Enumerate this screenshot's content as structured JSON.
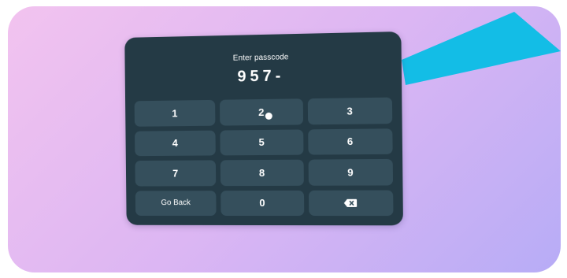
{
  "keypad": {
    "title": "Enter passcode",
    "code": "957-",
    "keys": [
      "1",
      "2",
      "3",
      "4",
      "5",
      "6",
      "7",
      "8",
      "9",
      "Go Back",
      "0"
    ],
    "backspace_icon": "backspace-icon"
  },
  "colors": {
    "panel": "#243a45",
    "key": "#354f5c",
    "beam": "#13bde6"
  }
}
